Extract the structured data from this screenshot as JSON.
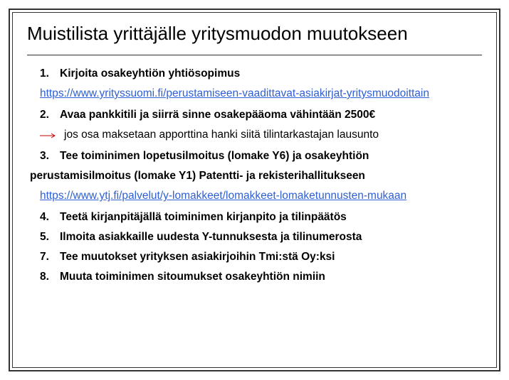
{
  "title": "Muistilista yrittäjälle yritysmuodon muutokseen",
  "items": [
    {
      "num": "1.",
      "text": "Kirjoita osakeyhtiön yhtiösopimus"
    },
    {
      "num": "2.",
      "text": "Avaa pankkitili ja siirrä sinne osakepääoma vähintään 2500€"
    },
    {
      "num": "3.",
      "text": "Tee toiminimen lopetusilmoitus (lomake Y6) ja osakeyhtiön"
    },
    {
      "num": "4.",
      "text": "Teetä kirjanpitäjällä toiminimen kirjanpito ja tilinpäätös"
    },
    {
      "num": "5.",
      "text": "Ilmoita asiakkaille uudesta Y-tunnuksesta ja tilinumerosta"
    },
    {
      "num": "7.",
      "text": "Tee muutokset yrityksen asiakirjoihin Tmi:stä Oy:ksi"
    },
    {
      "num": "8.",
      "text": "Muuta toiminimen sitoumukset osakeyhtiön nimiin"
    }
  ],
  "link1": "https://www.yrityssuomi.fi/perustamiseen-vaadittavat-asiakirjat-yritysmuodoittain",
  "subnote": "jos osa maksetaan apporttina hanki siitä tilintarkastajan lausunto",
  "item3_continuation": "perustamisilmoitus (lomake Y1) Patentti- ja rekisterihallitukseen",
  "link2": "https://www.ytj.fi/palvelut/y-lomakkeet/lomakkeet-lomaketunnusten-mukaan"
}
